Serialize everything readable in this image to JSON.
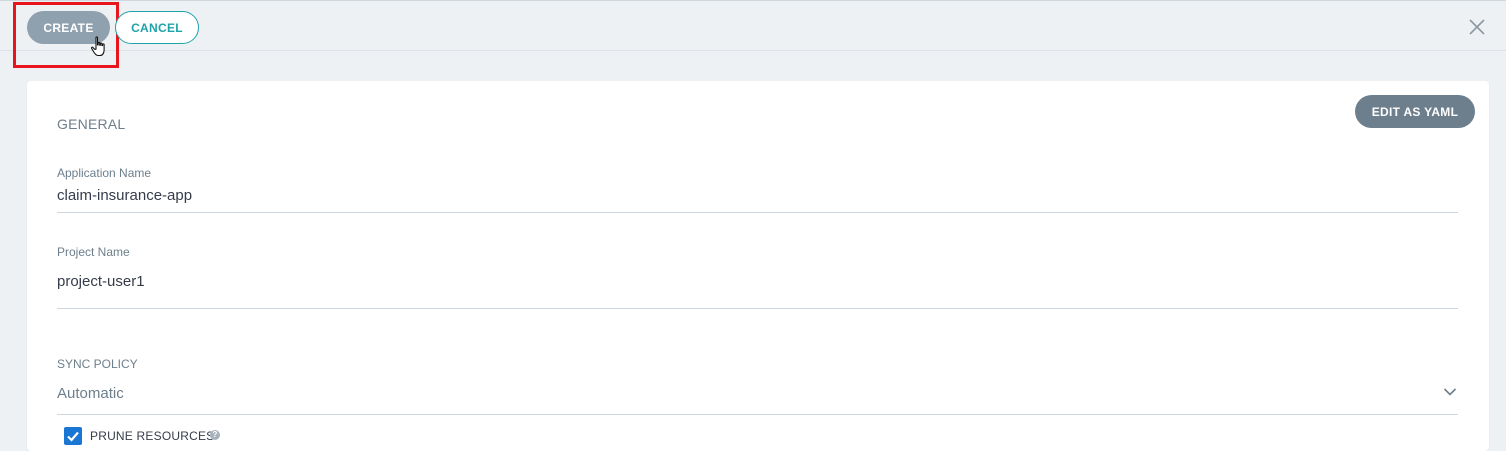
{
  "toolbar": {
    "create_label": "CREATE",
    "cancel_label": "CANCEL",
    "close_icon": "close-icon"
  },
  "panel": {
    "edit_yaml_label": "EDIT AS YAML",
    "general_title": "GENERAL",
    "app_name": {
      "label": "Application Name",
      "value": "claim-insurance-app"
    },
    "project_name": {
      "label": "Project Name",
      "value": "project-user1"
    },
    "sync_policy": {
      "label": "SYNC POLICY",
      "value": "Automatic",
      "icon": "chevron-down-icon"
    },
    "prune_resources": {
      "label": "PRUNE RESOURCES",
      "checked": true,
      "help_glyph": "?"
    }
  },
  "colors": {
    "background": "#eef1f4",
    "create_button": "#8fa0ae",
    "cancel_accent": "#1fa3a8",
    "yaml_button": "#6d7f8c",
    "highlight": "#e8151d",
    "checkbox": "#1976d2"
  }
}
